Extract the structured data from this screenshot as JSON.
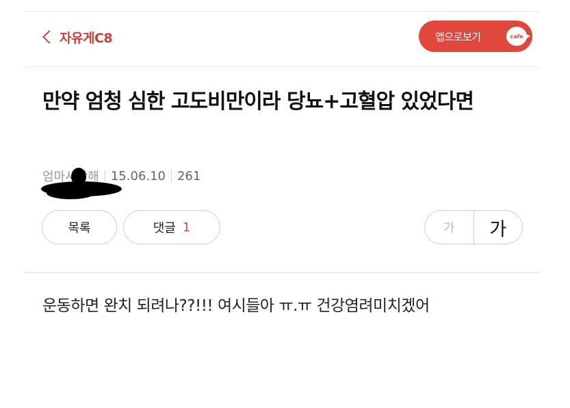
{
  "header": {
    "back_label": "자유게C8",
    "app_button_label": "앱으로보기",
    "cafe_badge": "cafe"
  },
  "post": {
    "title": "만약 엄청 심한 고도비만이라 당뇨+고혈압 있었다면",
    "author": "엄마사랑해",
    "date": "15.06.10",
    "views": "261",
    "body": "운동하면 완치 되려나??!!! 여시들아 ㅠ.ㅠ 건강염려미치겠어"
  },
  "actions": {
    "list_label": "목록",
    "comment_label": "댓글",
    "comment_count": "1",
    "font_small_label": "가",
    "font_large_label": "가"
  },
  "colors": {
    "accent": "#e0473d",
    "back_text": "#c8413a"
  }
}
